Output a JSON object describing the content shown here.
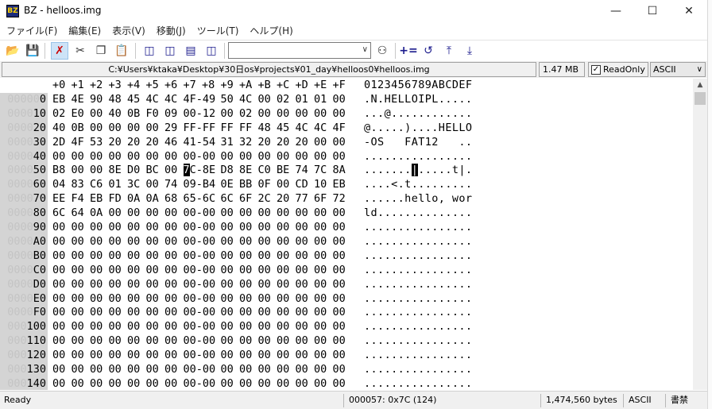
{
  "window": {
    "icon_text": "BZ",
    "title": "BZ - helloos.img"
  },
  "menu": [
    "ファイル(F)",
    "編集(E)",
    "表示(V)",
    "移動(J)",
    "ツール(T)",
    "ヘルプ(H)"
  ],
  "pathbar": {
    "path": "C:¥Users¥ktaka¥Desktop¥30日os¥projects¥01_day¥helloos0¥helloos.img",
    "size": "1.47 MB",
    "readonly_label": "ReadOnly",
    "readonly_checked": true,
    "encoding": "ASCII"
  },
  "hex": {
    "header_bytes": [
      "+0",
      "+1",
      "+2",
      "+3",
      "+4",
      "+5",
      "+6",
      "+7",
      "+8",
      "+9",
      "+A",
      "+B",
      "+C",
      "+D",
      "+E",
      "+F"
    ],
    "header_ascii": "0123456789ABCDEF",
    "cursor": {
      "row": 5,
      "col": 7
    },
    "rows": [
      {
        "addr_prefix": "00000",
        "addr": "0",
        "bytes": [
          "EB",
          "4E",
          "90",
          "48",
          "45",
          "4C",
          "4C",
          "4F-49",
          "50",
          "4C",
          "00",
          "02",
          "01",
          "01",
          "00"
        ],
        "ascii": ".N.HELLOIPL....."
      },
      {
        "addr_prefix": "0000",
        "addr": "10",
        "bytes": [
          "02",
          "E0",
          "00",
          "40",
          "0B",
          "F0",
          "09",
          "00-12",
          "00",
          "02",
          "00",
          "00",
          "00",
          "00",
          "00"
        ],
        "ascii": "...@............"
      },
      {
        "addr_prefix": "0000",
        "addr": "20",
        "bytes": [
          "40",
          "0B",
          "00",
          "00",
          "00",
          "00",
          "29",
          "FF-FF",
          "FF",
          "FF",
          "48",
          "45",
          "4C",
          "4C",
          "4F"
        ],
        "ascii": "@.....)....HELLO"
      },
      {
        "addr_prefix": "0000",
        "addr": "30",
        "bytes": [
          "2D",
          "4F",
          "53",
          "20",
          "20",
          "20",
          "46",
          "41-54",
          "31",
          "32",
          "20",
          "20",
          "20",
          "00",
          "00"
        ],
        "ascii": "-OS   FAT12   .."
      },
      {
        "addr_prefix": "0000",
        "addr": "40",
        "bytes": [
          "00",
          "00",
          "00",
          "00",
          "00",
          "00",
          "00",
          "00-00",
          "00",
          "00",
          "00",
          "00",
          "00",
          "00",
          "00"
        ],
        "ascii": "................"
      },
      {
        "addr_prefix": "0000",
        "addr": "50",
        "bytes": [
          "B8",
          "00",
          "00",
          "8E",
          "D0",
          "BC",
          "00",
          "7C-8E",
          "D8",
          "8E",
          "C0",
          "BE",
          "74",
          "7C",
          "8A"
        ],
        "ascii": ".......|.....t|."
      },
      {
        "addr_prefix": "0000",
        "addr": "60",
        "bytes": [
          "04",
          "83",
          "C6",
          "01",
          "3C",
          "00",
          "74",
          "09-B4",
          "0E",
          "BB",
          "0F",
          "00",
          "CD",
          "10",
          "EB"
        ],
        "ascii": "....<.t........."
      },
      {
        "addr_prefix": "0000",
        "addr": "70",
        "bytes": [
          "EE",
          "F4",
          "EB",
          "FD",
          "0A",
          "0A",
          "68",
          "65-6C",
          "6C",
          "6F",
          "2C",
          "20",
          "77",
          "6F",
          "72"
        ],
        "ascii": "......hello, wor"
      },
      {
        "addr_prefix": "0000",
        "addr": "80",
        "bytes": [
          "6C",
          "64",
          "0A",
          "00",
          "00",
          "00",
          "00",
          "00-00",
          "00",
          "00",
          "00",
          "00",
          "00",
          "00",
          "00"
        ],
        "ascii": "ld.............."
      },
      {
        "addr_prefix": "0000",
        "addr": "90",
        "bytes": [
          "00",
          "00",
          "00",
          "00",
          "00",
          "00",
          "00",
          "00-00",
          "00",
          "00",
          "00",
          "00",
          "00",
          "00",
          "00"
        ],
        "ascii": "................"
      },
      {
        "addr_prefix": "0000",
        "addr": "A0",
        "bytes": [
          "00",
          "00",
          "00",
          "00",
          "00",
          "00",
          "00",
          "00-00",
          "00",
          "00",
          "00",
          "00",
          "00",
          "00",
          "00"
        ],
        "ascii": "................"
      },
      {
        "addr_prefix": "0000",
        "addr": "B0",
        "bytes": [
          "00",
          "00",
          "00",
          "00",
          "00",
          "00",
          "00",
          "00-00",
          "00",
          "00",
          "00",
          "00",
          "00",
          "00",
          "00"
        ],
        "ascii": "................"
      },
      {
        "addr_prefix": "0000",
        "addr": "C0",
        "bytes": [
          "00",
          "00",
          "00",
          "00",
          "00",
          "00",
          "00",
          "00-00",
          "00",
          "00",
          "00",
          "00",
          "00",
          "00",
          "00"
        ],
        "ascii": "................"
      },
      {
        "addr_prefix": "0000",
        "addr": "D0",
        "bytes": [
          "00",
          "00",
          "00",
          "00",
          "00",
          "00",
          "00",
          "00-00",
          "00",
          "00",
          "00",
          "00",
          "00",
          "00",
          "00"
        ],
        "ascii": "................"
      },
      {
        "addr_prefix": "0000",
        "addr": "E0",
        "bytes": [
          "00",
          "00",
          "00",
          "00",
          "00",
          "00",
          "00",
          "00-00",
          "00",
          "00",
          "00",
          "00",
          "00",
          "00",
          "00"
        ],
        "ascii": "................"
      },
      {
        "addr_prefix": "0000",
        "addr": "F0",
        "bytes": [
          "00",
          "00",
          "00",
          "00",
          "00",
          "00",
          "00",
          "00-00",
          "00",
          "00",
          "00",
          "00",
          "00",
          "00",
          "00"
        ],
        "ascii": "................"
      },
      {
        "addr_prefix": "000",
        "addr": "100",
        "bytes": [
          "00",
          "00",
          "00",
          "00",
          "00",
          "00",
          "00",
          "00-00",
          "00",
          "00",
          "00",
          "00",
          "00",
          "00",
          "00"
        ],
        "ascii": "................"
      },
      {
        "addr_prefix": "000",
        "addr": "110",
        "bytes": [
          "00",
          "00",
          "00",
          "00",
          "00",
          "00",
          "00",
          "00-00",
          "00",
          "00",
          "00",
          "00",
          "00",
          "00",
          "00"
        ],
        "ascii": "................"
      },
      {
        "addr_prefix": "000",
        "addr": "120",
        "bytes": [
          "00",
          "00",
          "00",
          "00",
          "00",
          "00",
          "00",
          "00-00",
          "00",
          "00",
          "00",
          "00",
          "00",
          "00",
          "00"
        ],
        "ascii": "................"
      },
      {
        "addr_prefix": "000",
        "addr": "130",
        "bytes": [
          "00",
          "00",
          "00",
          "00",
          "00",
          "00",
          "00",
          "00-00",
          "00",
          "00",
          "00",
          "00",
          "00",
          "00",
          "00"
        ],
        "ascii": "................"
      },
      {
        "addr_prefix": "000",
        "addr": "140",
        "bytes": [
          "00",
          "00",
          "00",
          "00",
          "00",
          "00",
          "00",
          "00-00",
          "00",
          "00",
          "00",
          "00",
          "00",
          "00",
          "00"
        ],
        "ascii": "................"
      }
    ]
  },
  "status": {
    "state": "Ready",
    "position": "000057: 0x7C (124)",
    "filesize": "1,474,560 bytes",
    "encoding": "ASCII",
    "mode": "書禁"
  }
}
